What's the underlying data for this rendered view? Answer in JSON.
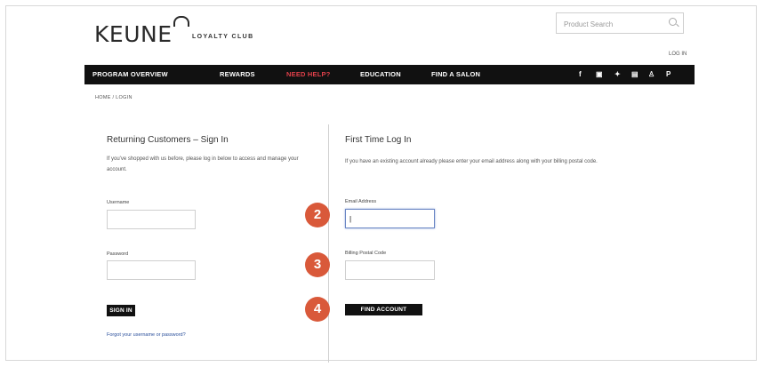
{
  "brand": {
    "name": "KEUNE",
    "sub": "LOYALTY CLUB"
  },
  "search": {
    "placeholder": "Product Search"
  },
  "header": {
    "login_link": "LOG IN"
  },
  "nav": {
    "items": [
      "PROGRAM OVERVIEW",
      "REWARDS",
      "NEED HELP?",
      "EDUCATION",
      "FIND A SALON"
    ],
    "active_index": 2,
    "social": [
      "f",
      "▣",
      "✦",
      "▤",
      "♙",
      "P"
    ]
  },
  "breadcrumb": "HOME / LOGIN",
  "returning": {
    "title": "Returning Customers – Sign In",
    "text": "If you've shopped with us before, please log in below to access and manage your account.",
    "username_label": "Username",
    "password_label": "Password",
    "button": "SIGN IN",
    "forgot": "Forgot your username or password?"
  },
  "first_time": {
    "title": "First Time Log In",
    "text": "If you have an existing account already please enter your email address along with your billing postal code.",
    "email_label": "Email Address",
    "email_value": "|",
    "postal_label": "Billing Postal Code",
    "button": "FIND ACCOUNT"
  },
  "steps": [
    "2",
    "3",
    "4"
  ],
  "colors": {
    "accent": "#d9593a",
    "nav_bg": "#111111",
    "nav_active": "#e0404a"
  }
}
